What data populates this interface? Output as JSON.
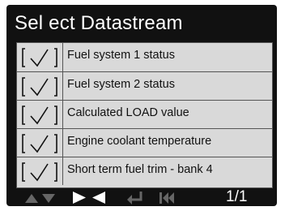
{
  "header": {
    "title": "Sel ect Datastream"
  },
  "datastream_list": {
    "items": [
      {
        "label": "Fuel system 1 status",
        "checked": true
      },
      {
        "label": "Fuel system 2 status",
        "checked": true
      },
      {
        "label": "Calculated LOAD value",
        "checked": true
      },
      {
        "label": "Engine coolant temperature",
        "checked": true
      },
      {
        "label": "Short term fuel trim - bank 4",
        "checked": true
      }
    ]
  },
  "footer": {
    "page_indicator": "1/1",
    "icons": [
      "up-down-arrows-icon",
      "select-arrows-icon",
      "return-icon",
      "skip-back-icon"
    ],
    "colors": {
      "active_icon": "#ffffff",
      "inactive_icon": "#666666"
    }
  },
  "colors": {
    "screen_background": "#111111",
    "list_background": "#d9d9d9",
    "title_text": "#ffffff"
  }
}
